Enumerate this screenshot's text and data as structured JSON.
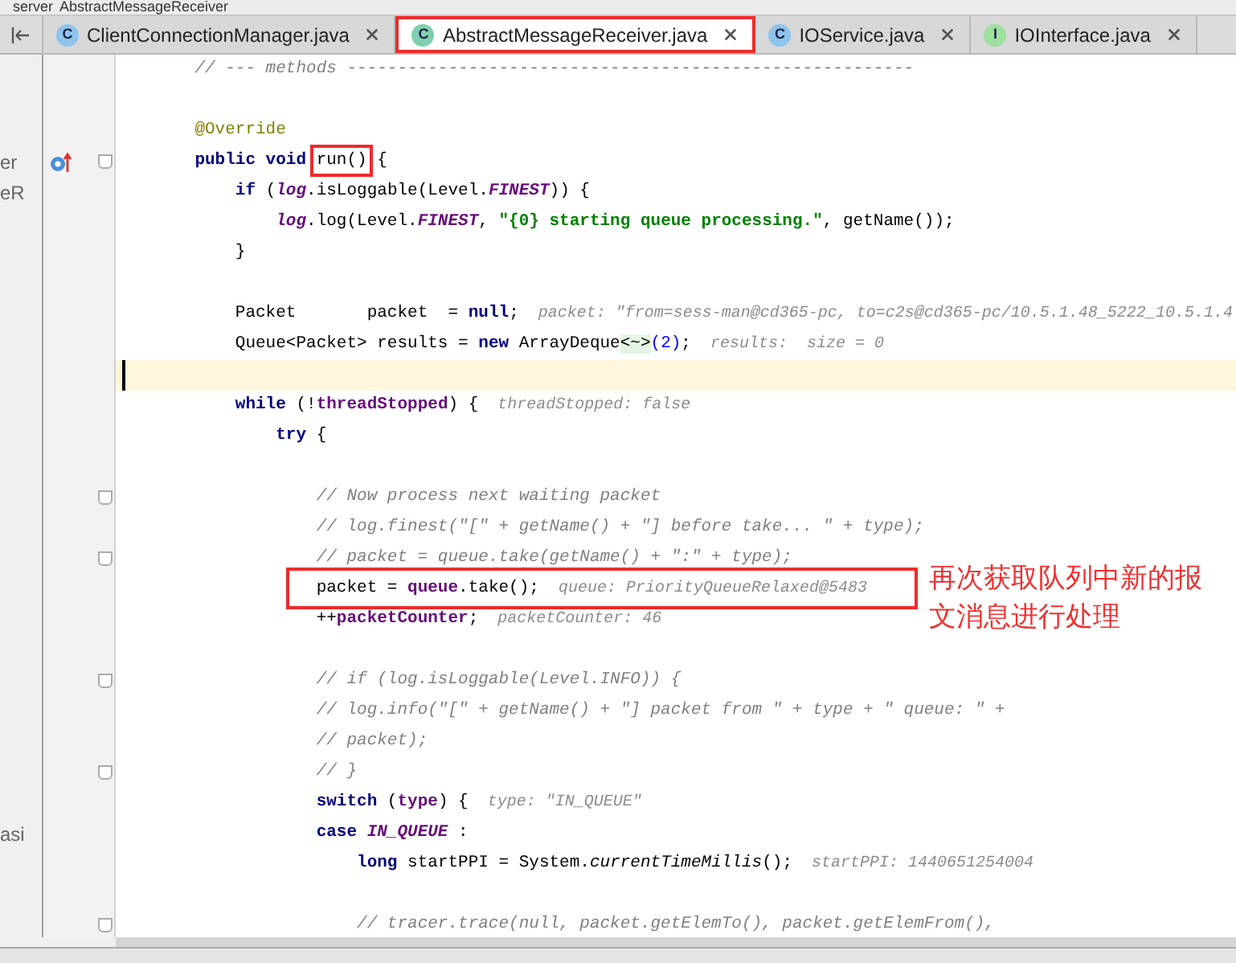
{
  "breadcrumb": [
    "server",
    "AbstractMessageReceiver"
  ],
  "tabs": [
    {
      "label": "ClientConnectionManager.java",
      "icon_letter": "C",
      "color": "#8ec4ec",
      "selected": false,
      "boxed": false
    },
    {
      "label": "AbstractMessageReceiver.java",
      "icon_letter": "C",
      "color": "#7fd0b0",
      "selected": true,
      "boxed": true
    },
    {
      "label": "IOService.java",
      "icon_letter": "C",
      "color": "#8ec4ec",
      "selected": false,
      "boxed": false
    },
    {
      "label": "IOInterface.java",
      "icon_letter": "I",
      "color": "#9ee09e",
      "selected": false,
      "boxed": false
    }
  ],
  "lines": [
    {
      "current": false,
      "fold": false,
      "override": false,
      "tokens": [
        {
          "kind": "cmt",
          "text": "    // --- methods --------------------------------------------------------"
        }
      ]
    },
    {
      "current": false,
      "fold": false,
      "override": false
    },
    {
      "current": false,
      "fold": false,
      "override": false,
      "tokens": [
        {
          "kind": "ann",
          "text": "    @Override"
        }
      ]
    },
    {
      "current": false,
      "fold": true,
      "override": true,
      "side_text": "er",
      "tokens": [
        {
          "kind": "kw",
          "text": "    public void "
        },
        {
          "kind": "txt",
          "text": "run()",
          "boxed": true
        },
        {
          "kind": "txt",
          "text": " {"
        }
      ]
    },
    {
      "current": false,
      "fold": false,
      "override": false,
      "side_text": "eR",
      "tokens": [
        {
          "kind": "kw",
          "text": "        if"
        },
        {
          "kind": "txt",
          "text": " ("
        },
        {
          "kind": "sfld",
          "text": "log"
        },
        {
          "kind": "txt",
          "text": ".isLoggable(Level."
        },
        {
          "kind": "sfld",
          "text": "FINEST"
        },
        {
          "kind": "txt",
          "text": ")) {"
        }
      ]
    },
    {
      "current": false,
      "fold": false,
      "override": false,
      "tokens": [
        {
          "kind": "sfld",
          "text": "            log"
        },
        {
          "kind": "txt",
          "text": ".log(Level."
        },
        {
          "kind": "sfld",
          "text": "FINEST"
        },
        {
          "kind": "txt",
          "text": ", "
        },
        {
          "kind": "str",
          "text": "\"{0} starting queue processing.\""
        },
        {
          "kind": "txt",
          "text": ", getName());"
        }
      ]
    },
    {
      "current": false,
      "fold": false,
      "override": false,
      "tokens": [
        {
          "kind": "txt",
          "text": "        }"
        }
      ]
    },
    {
      "current": false,
      "fold": false,
      "override": false
    },
    {
      "current": false,
      "fold": false,
      "override": false,
      "tokens": [
        {
          "kind": "txt",
          "text": "        Packet       packet  = "
        },
        {
          "kind": "kw",
          "text": "null"
        },
        {
          "kind": "txt",
          "text": ";"
        }
      ],
      "hint": "packet: \"from=sess-man@cd365-pc, to=c2s@cd365-pc/10.5.1.48_5222_10.5.1.4"
    },
    {
      "current": false,
      "fold": false,
      "override": false,
      "tokens": [
        {
          "kind": "txt",
          "text": "        Queue<Packet> results = "
        },
        {
          "kind": "kw",
          "text": "new"
        },
        {
          "kind": "txt",
          "text": " ArrayDeque"
        },
        {
          "kind": "diam",
          "text": "<~>"
        },
        {
          "kind": "num",
          "text": "(2)"
        },
        {
          "kind": "txt",
          "text": ";"
        }
      ],
      "hint": "results:  size = 0"
    },
    {
      "current": true,
      "fold": false,
      "override": false
    },
    {
      "current": false,
      "fold": false,
      "override": false,
      "tokens": [
        {
          "kind": "kw",
          "text": "        while"
        },
        {
          "kind": "txt",
          "text": " (!"
        },
        {
          "kind": "fld",
          "text": "threadStopped"
        },
        {
          "kind": "txt",
          "text": ") {"
        }
      ],
      "hint": "threadStopped: false"
    },
    {
      "current": false,
      "fold": false,
      "override": false,
      "tokens": [
        {
          "kind": "kw",
          "text": "            try"
        },
        {
          "kind": "txt",
          "text": " {"
        }
      ]
    },
    {
      "current": false,
      "fold": false,
      "override": false
    },
    {
      "current": false,
      "fold": true,
      "override": false,
      "tokens": [
        {
          "kind": "cmt",
          "text": "                // Now process next waiting packet"
        }
      ]
    },
    {
      "current": false,
      "fold": false,
      "override": false,
      "tokens": [
        {
          "kind": "cmt",
          "text": "                // log.finest(\"[\" + getName() + \"] before take... \" + type);"
        }
      ]
    },
    {
      "current": false,
      "fold": true,
      "override": false,
      "tokens": [
        {
          "kind": "cmt",
          "text": "                // packet = queue.take(getName() + \":\" + type);"
        }
      ]
    },
    {
      "current": false,
      "fold": false,
      "override": false,
      "boxed": true,
      "note": "再次获取队列中新的报文消息进行处理",
      "tokens": [
        {
          "kind": "txt",
          "text": "                packet = "
        },
        {
          "kind": "fld",
          "text": "queue"
        },
        {
          "kind": "txt",
          "text": ".take();"
        }
      ],
      "hint": "queue: PriorityQueueRelaxed@5483"
    },
    {
      "current": false,
      "fold": false,
      "override": false,
      "tokens": [
        {
          "kind": "txt",
          "text": "                ++"
        },
        {
          "kind": "fld",
          "text": "packetCounter"
        },
        {
          "kind": "txt",
          "text": ";"
        }
      ],
      "hint": "packetCounter: 46"
    },
    {
      "current": false,
      "fold": false,
      "override": false
    },
    {
      "current": false,
      "fold": true,
      "override": false,
      "tokens": [
        {
          "kind": "cmt",
          "text": "                // if (log.isLoggable(Level.INFO)) {"
        }
      ]
    },
    {
      "current": false,
      "fold": false,
      "override": false,
      "tokens": [
        {
          "kind": "cmt",
          "text": "                // log.info(\"[\" + getName() + \"] packet from \" + type + \" queue: \" +"
        }
      ]
    },
    {
      "current": false,
      "fold": false,
      "override": false,
      "tokens": [
        {
          "kind": "cmt",
          "text": "                // packet);"
        }
      ]
    },
    {
      "current": false,
      "fold": true,
      "override": false,
      "tokens": [
        {
          "kind": "cmt",
          "text": "                // }"
        }
      ]
    },
    {
      "current": false,
      "fold": false,
      "override": false,
      "tokens": [
        {
          "kind": "kw",
          "text": "                switch"
        },
        {
          "kind": "txt",
          "text": " ("
        },
        {
          "kind": "fld",
          "text": "type"
        },
        {
          "kind": "txt",
          "text": ") {"
        }
      ],
      "hint": "type: \"IN_QUEUE\""
    },
    {
      "current": false,
      "fold": false,
      "override": false,
      "side_text": "asi",
      "tokens": [
        {
          "kind": "kw",
          "text": "                case "
        },
        {
          "kind": "sfld",
          "text": "IN_QUEUE"
        },
        {
          "kind": "txt",
          "text": " :"
        }
      ]
    },
    {
      "current": false,
      "fold": false,
      "override": false,
      "tokens": [
        {
          "kind": "kw",
          "text": "                    long"
        },
        {
          "kind": "txt",
          "text": " startPPI = System."
        },
        {
          "kind": "smeth",
          "text": "currentTimeMillis"
        },
        {
          "kind": "txt",
          "text": "();"
        }
      ],
      "hint": "startPPI: 1440651254004"
    },
    {
      "current": false,
      "fold": false,
      "override": false
    },
    {
      "current": false,
      "fold": true,
      "override": false,
      "tokens": [
        {
          "kind": "cmt",
          "text": "                    // tracer.trace(null, packet.getElemTo(), packet.getElemFrom(),"
        }
      ]
    }
  ]
}
